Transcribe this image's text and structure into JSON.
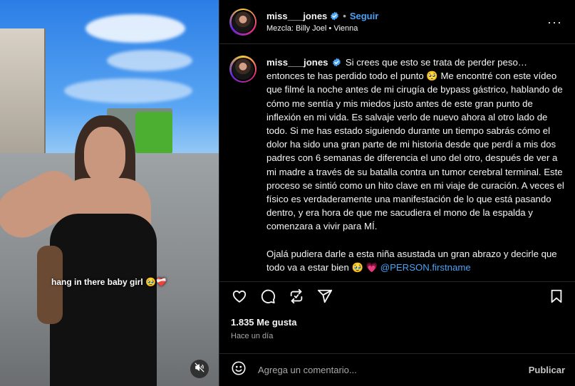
{
  "media": {
    "overlay_text": "hang in there baby girl 🥹❤️‍🩹"
  },
  "post": {
    "username": "miss___jones",
    "follow_label": "Seguir",
    "separator": "•",
    "audio": "Mezcla: Billy Joel • Vienna",
    "more_label": "···",
    "caption_p1": "Si crees que esto se trata de perder peso… entonces te has perdido todo el punto 🥺 Me encontré con este vídeo que filmé la noche antes de mi cirugía de bypass gástrico, hablando de cómo me sentía y mis miedos justo antes de este gran punto de inflexión en mi vida. Es salvaje verlo de nuevo ahora al otro lado de todo. Si me has estado siguiendo durante un tiempo sabrás cómo el dolor ha sido una gran parte de mi historia desde que perdí a mis dos padres con 6 semanas de diferencia el uno del otro, después de ver a mi madre a través de su batalla contra un tumor cerebral terminal. Este proceso se sintió como un hito clave en mi viaje de curación. A veces el físico es verdaderamente una manifestación de lo que está pasando dentro, y era hora de que me sacudiera el mono de la espalda y comenzara a vivir para MÍ.",
    "caption_p2": "Ojalá pudiera darle a esta niña asustada un gran abrazo y decirle que todo va a estar bien 🥹 💗",
    "mention": "@PERSON.firstname",
    "likes": "1.835 Me gusta",
    "time_ago": "Hace un día"
  },
  "comment": {
    "placeholder": "Agrega un comentario...",
    "publish_label": "Publicar"
  },
  "icons": {
    "like": "heart-icon",
    "comment": "comment-icon",
    "share": "repost-icon",
    "send": "send-icon",
    "save": "bookmark-icon",
    "emoji": "emoji-icon",
    "mute": "speaker-muted-icon",
    "verified": "verified-badge-icon"
  },
  "colors": {
    "background": "#000000",
    "text": "#f5f5f5",
    "secondary_text": "#a8a8a8",
    "link": "#4aa3f5",
    "divider": "#262626"
  }
}
